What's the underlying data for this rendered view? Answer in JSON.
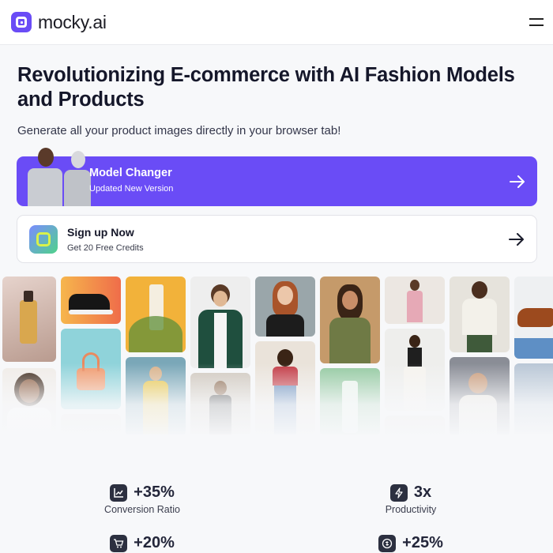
{
  "header": {
    "brand_name": "mocky.ai",
    "logo_icon": "mocky-logo-icon",
    "menu_icon": "hamburger-menu-icon"
  },
  "hero": {
    "title": "Revolutionizing E-commerce with AI Fashion Models and Products",
    "subtitle": "Generate all your product images directly in your browser tab!"
  },
  "cards": {
    "model_changer": {
      "title": "Model Changer",
      "description": "Updated New Version",
      "arrow_icon": "arrow-right-icon"
    },
    "signup": {
      "title": "Sign up Now",
      "description": "Get 20 Free Credits",
      "icon": "gift-icon",
      "arrow_icon": "arrow-right-icon"
    }
  },
  "stats": [
    {
      "value": "+35%",
      "label": "Conversion Ratio",
      "icon": "chart-icon"
    },
    {
      "value": "3x",
      "label": "Productivity",
      "icon": "lightning-icon"
    },
    {
      "value": "+20%",
      "label": "",
      "icon": "cart-icon"
    },
    {
      "value": "+25%",
      "label": "",
      "icon": "coin-icon"
    }
  ],
  "colors": {
    "accent": "#6a4cf6",
    "background": "#f7f8fa",
    "text": "#15172a"
  }
}
